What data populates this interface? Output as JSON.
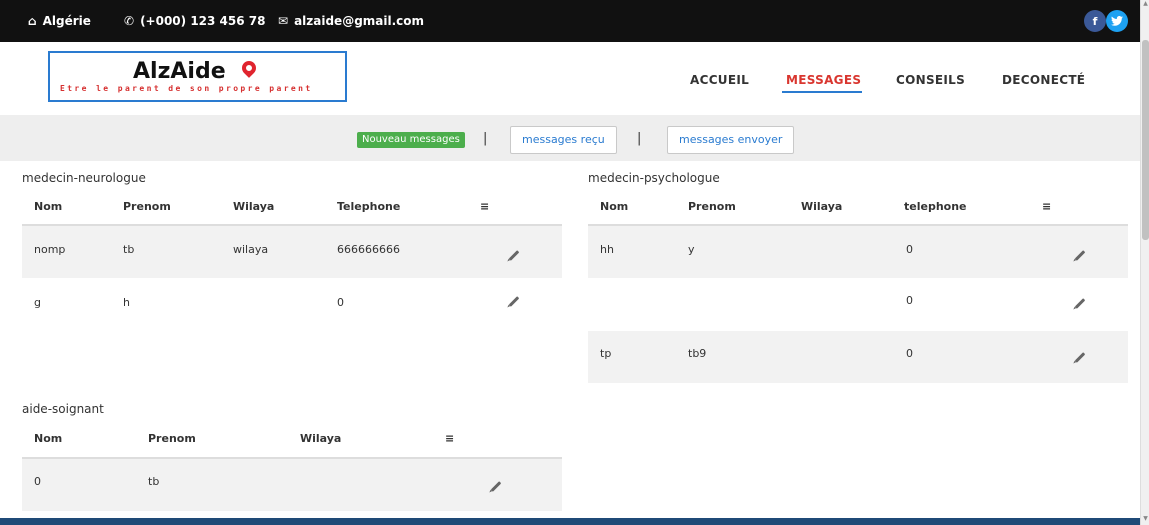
{
  "topbar": {
    "country": "Algérie",
    "phone": "(+000) 123 456 78",
    "email": "alzaide@gmail.com",
    "facebook": "f",
    "twitter": "t"
  },
  "logo": {
    "title": "AlzAide",
    "tagline": "Etre le parent de son propre parent"
  },
  "nav": {
    "items": [
      "ACCUEIL",
      "MESSAGES",
      "CONSEILS",
      "DECONECTÉ"
    ],
    "active": "MESSAGES"
  },
  "messages_bar": {
    "new_label": "Nouveau messages",
    "received_label": "messages reçu",
    "sent_label": "messages envoyer",
    "separator": "|"
  },
  "tables": {
    "neuro": {
      "title": "medecin-neurologue",
      "headers": [
        "Nom",
        "Prenom",
        "Wilaya",
        "Telephone",
        "≡"
      ],
      "rows": [
        [
          "nomp",
          "tb",
          "wilaya",
          "666666666"
        ],
        [
          "g",
          "h",
          "",
          "0"
        ]
      ]
    },
    "psycho": {
      "title": "medecin-psychologue",
      "headers": [
        "Nom",
        "Prenom",
        "Wilaya",
        "telephone",
        "≡"
      ],
      "rows": [
        [
          "hh",
          "y",
          "",
          "0"
        ],
        [
          "",
          "",
          "",
          "0"
        ],
        [
          "tp",
          "tb9",
          "",
          "0"
        ]
      ]
    },
    "aide": {
      "title": "aide-soignant",
      "headers": [
        "Nom",
        "Prenom",
        "Wilaya",
        "≡"
      ],
      "rows": [
        [
          "0",
          "tb",
          ""
        ]
      ]
    }
  },
  "colors": {
    "accent_blue": "#2a7bd0",
    "active_nav_red": "#d9362f",
    "new_button_green": "#4cae4c",
    "topbar_bg": "#111111"
  },
  "icons": {
    "home": "home-icon",
    "phone": "phone-icon",
    "mail": "mail-icon",
    "menu": "menu-icon",
    "edit": "pencil-icon"
  }
}
